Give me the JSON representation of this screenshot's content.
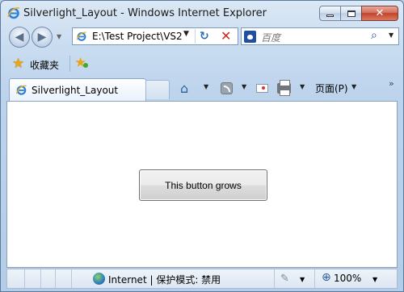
{
  "window": {
    "title": "Silverlight_Layout - Windows Internet Explorer"
  },
  "address": {
    "url": "E:\\Test Project\\VS2"
  },
  "search": {
    "placeholder": "百度"
  },
  "favorites": {
    "label": "收藏夹"
  },
  "tabs": [
    {
      "label": "Silverlight_Layout",
      "active": true
    }
  ],
  "commandbar": {
    "page_label": "页面(P)",
    "more": "»"
  },
  "content": {
    "button_label": "This button grows"
  },
  "statusbar": {
    "zone": "Internet | 保护模式: 禁用",
    "zoom": "100%"
  },
  "colors": {
    "frame": "#bcd3ec",
    "close_button": "#c3432b"
  },
  "icons": [
    "ie-icon",
    "back-icon",
    "forward-icon",
    "refresh-icon",
    "stop-icon",
    "search-icon",
    "star-icon",
    "add-favorite-icon",
    "home-icon",
    "feed-icon",
    "mail-icon",
    "print-icon",
    "globe-icon",
    "zoom-icon"
  ]
}
